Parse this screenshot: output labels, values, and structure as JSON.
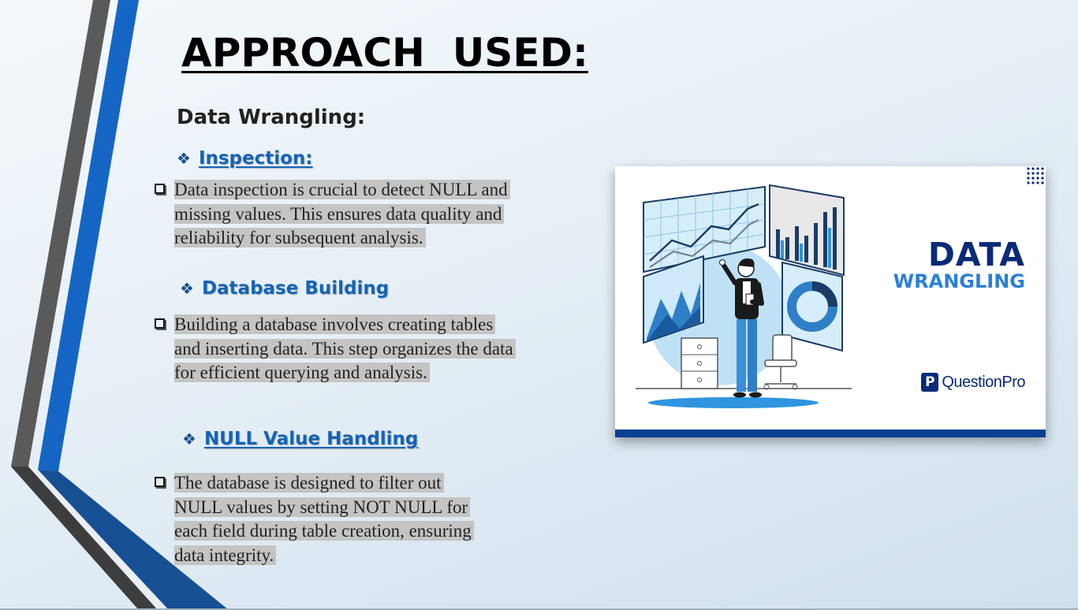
{
  "slide": {
    "title": "APPROACH  USED:",
    "subtitle": "Data Wrangling:"
  },
  "sections": [
    {
      "heading": "Inspection:",
      "text": "Data inspection is crucial to detect NULL and missing values. This ensures data quality and reliability for subsequent analysis."
    },
    {
      "heading": "Database Building",
      "text": "Building a database involves creating tables and inserting data. This step organizes the data for efficient querying and analysis."
    },
    {
      "heading": "NULL Value Handling",
      "text": "The database is designed to filter out NULL values by setting NOT NULL for each field during table creation, ensuring data integrity."
    }
  ],
  "image": {
    "title_line1": "DATA",
    "title_line2": "WRANGLING",
    "brand_mark": "P",
    "brand_name": "QuestionPro"
  },
  "icons": {
    "section_bullet": "diamond-cluster-icon",
    "paragraph_bullet": "square-box-icon"
  },
  "colors": {
    "heading_blue": "#1564b3",
    "highlight_gray": "#c4c4c4",
    "card_bar": "#0a3f91",
    "brand_navy": "#0a2a78"
  }
}
